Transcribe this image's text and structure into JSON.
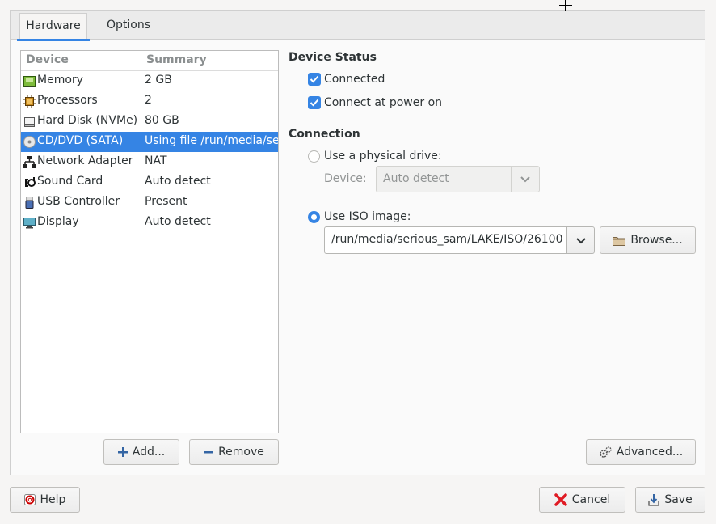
{
  "tabs": [
    {
      "label": "Hardware",
      "active": true
    },
    {
      "label": "Options",
      "active": false
    }
  ],
  "device_list": {
    "columns": [
      "Device",
      "Summary"
    ],
    "rows": [
      {
        "name": "Memory",
        "summary": "2 GB",
        "icon": "memory-icon"
      },
      {
        "name": "Processors",
        "summary": "2",
        "icon": "processor-icon"
      },
      {
        "name": "Hard Disk (NVMe)",
        "summary": "80 GB",
        "icon": "hard-disk-icon"
      },
      {
        "name": "CD/DVD (SATA)",
        "summary": "Using file /run/media/serious_sam",
        "icon": "cd-dvd-icon",
        "selected": true
      },
      {
        "name": "Network Adapter",
        "summary": "NAT",
        "icon": "network-icon"
      },
      {
        "name": "Sound Card",
        "summary": "Auto detect",
        "icon": "sound-card-icon"
      },
      {
        "name": "USB Controller",
        "summary": "Present",
        "icon": "usb-icon"
      },
      {
        "name": "Display",
        "summary": "Auto detect",
        "icon": "display-icon"
      }
    ],
    "add_label": "Add...",
    "remove_label": "Remove"
  },
  "device_status": {
    "heading": "Device Status",
    "connected_label": "Connected",
    "connected_checked": true,
    "power_on_label": "Connect at power on",
    "power_on_checked": true
  },
  "connection": {
    "heading": "Connection",
    "physical_label": "Use a physical drive:",
    "physical_selected": false,
    "device_label": "Device:",
    "device_value": "Auto detect",
    "iso_label": "Use ISO image:",
    "iso_selected": true,
    "iso_path": "/run/media/serious_sam/LAKE/ISO/26100",
    "browse_label": "Browse..."
  },
  "advanced_label": "Advanced...",
  "footer": {
    "help_label": "Help",
    "cancel_label": "Cancel",
    "save_label": "Save"
  },
  "colors": {
    "accent": "#3584e4",
    "cancel_icon": "#e01b24"
  }
}
